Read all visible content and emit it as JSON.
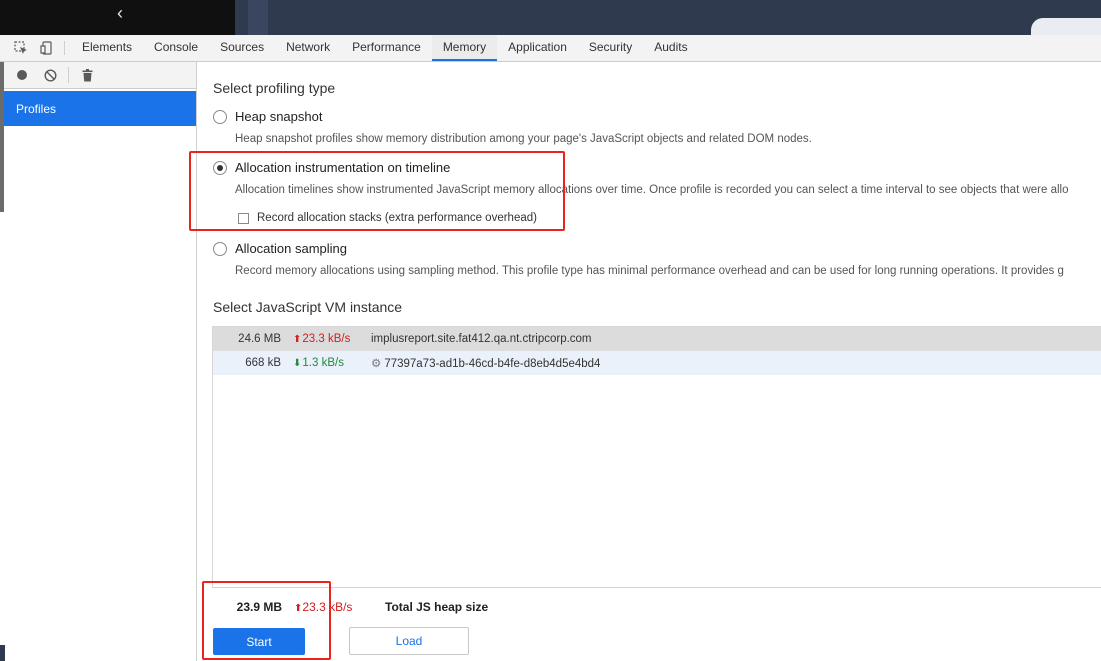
{
  "devtools": {
    "tabs": [
      "Elements",
      "Console",
      "Sources",
      "Network",
      "Performance",
      "Memory",
      "Application",
      "Security",
      "Audits"
    ],
    "active_tab": "Memory"
  },
  "sidebar": {
    "profiles_label": "Profiles"
  },
  "profiling": {
    "title": "Select profiling type",
    "options": [
      {
        "label": "Heap snapshot",
        "description": "Heap snapshot profiles show memory distribution among your page's JavaScript objects and related DOM nodes.",
        "checked": false
      },
      {
        "label": "Allocation instrumentation on timeline",
        "description": "Allocation timelines show instrumented JavaScript memory allocations over time. Once profile is recorded you can select a time interval to see objects that were allo",
        "checked": true,
        "checkbox_label": "Record allocation stacks (extra performance overhead)"
      },
      {
        "label": "Allocation sampling",
        "description": "Record memory allocations using sampling method. This profile type has minimal performance overhead and can be used for long running operations. It provides g",
        "checked": false
      }
    ]
  },
  "vm": {
    "title": "Select JavaScript VM instance",
    "instances": [
      {
        "size": "24.6 MB",
        "rate": "23.3 kB/s",
        "trend": "up",
        "name": "implusreport.site.fat412.qa.nt.ctripcorp.com"
      },
      {
        "size": "668 kB",
        "rate": "1.3 kB/s",
        "trend": "down",
        "name": "77397a73-ad1b-46cd-b4fe-d8eb4d5e4bd4"
      }
    ]
  },
  "footer": {
    "total_size": "23.9 MB",
    "total_rate": "23.3 kB/s",
    "total_label": "Total JS heap size",
    "start_label": "Start",
    "load_label": "Load"
  },
  "colors": {
    "accent": "#1a73e8",
    "annotation": "#e8251d",
    "rate_up": "#d11e1e",
    "rate_down": "#1f8a3a"
  }
}
